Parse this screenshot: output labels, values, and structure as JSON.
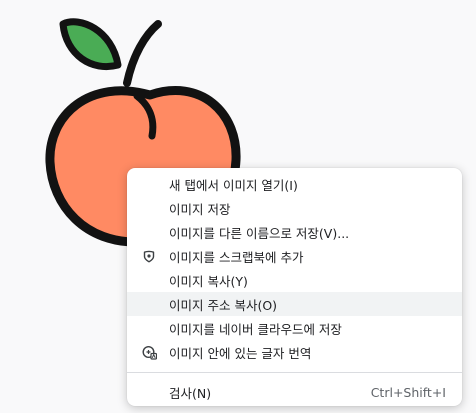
{
  "image_icons": [
    "peach-icon",
    "leaf-icon"
  ],
  "colors": {
    "peach": "#ff8a63",
    "leaf": "#4aac55",
    "outline": "#121212",
    "menu_bg": "#ffffff",
    "menu_highlight": "#f1f3f4",
    "menu_text": "#202124",
    "shortcut_text": "#5f6368"
  },
  "context_menu": {
    "items": [
      {
        "label": "새 탭에서 이미지 열기(I)"
      },
      {
        "label": "이미지 저장"
      },
      {
        "label": "이미지를 다른 이름으로 저장(V)..."
      },
      {
        "label": "이미지를 스크랩북에 추가",
        "icon": "scrapbook-icon"
      },
      {
        "label": "이미지 복사(Y)"
      },
      {
        "label": "이미지 주소 복사(O)",
        "highlighted": true
      },
      {
        "label": "이미지를 네이버 클라우드에 저장"
      },
      {
        "label": "이미지 안에 있는 글자 번역",
        "icon": "translate-icon"
      }
    ],
    "search": {
      "label": "검사(N)",
      "shortcut": "Ctrl+Shift+I"
    }
  }
}
